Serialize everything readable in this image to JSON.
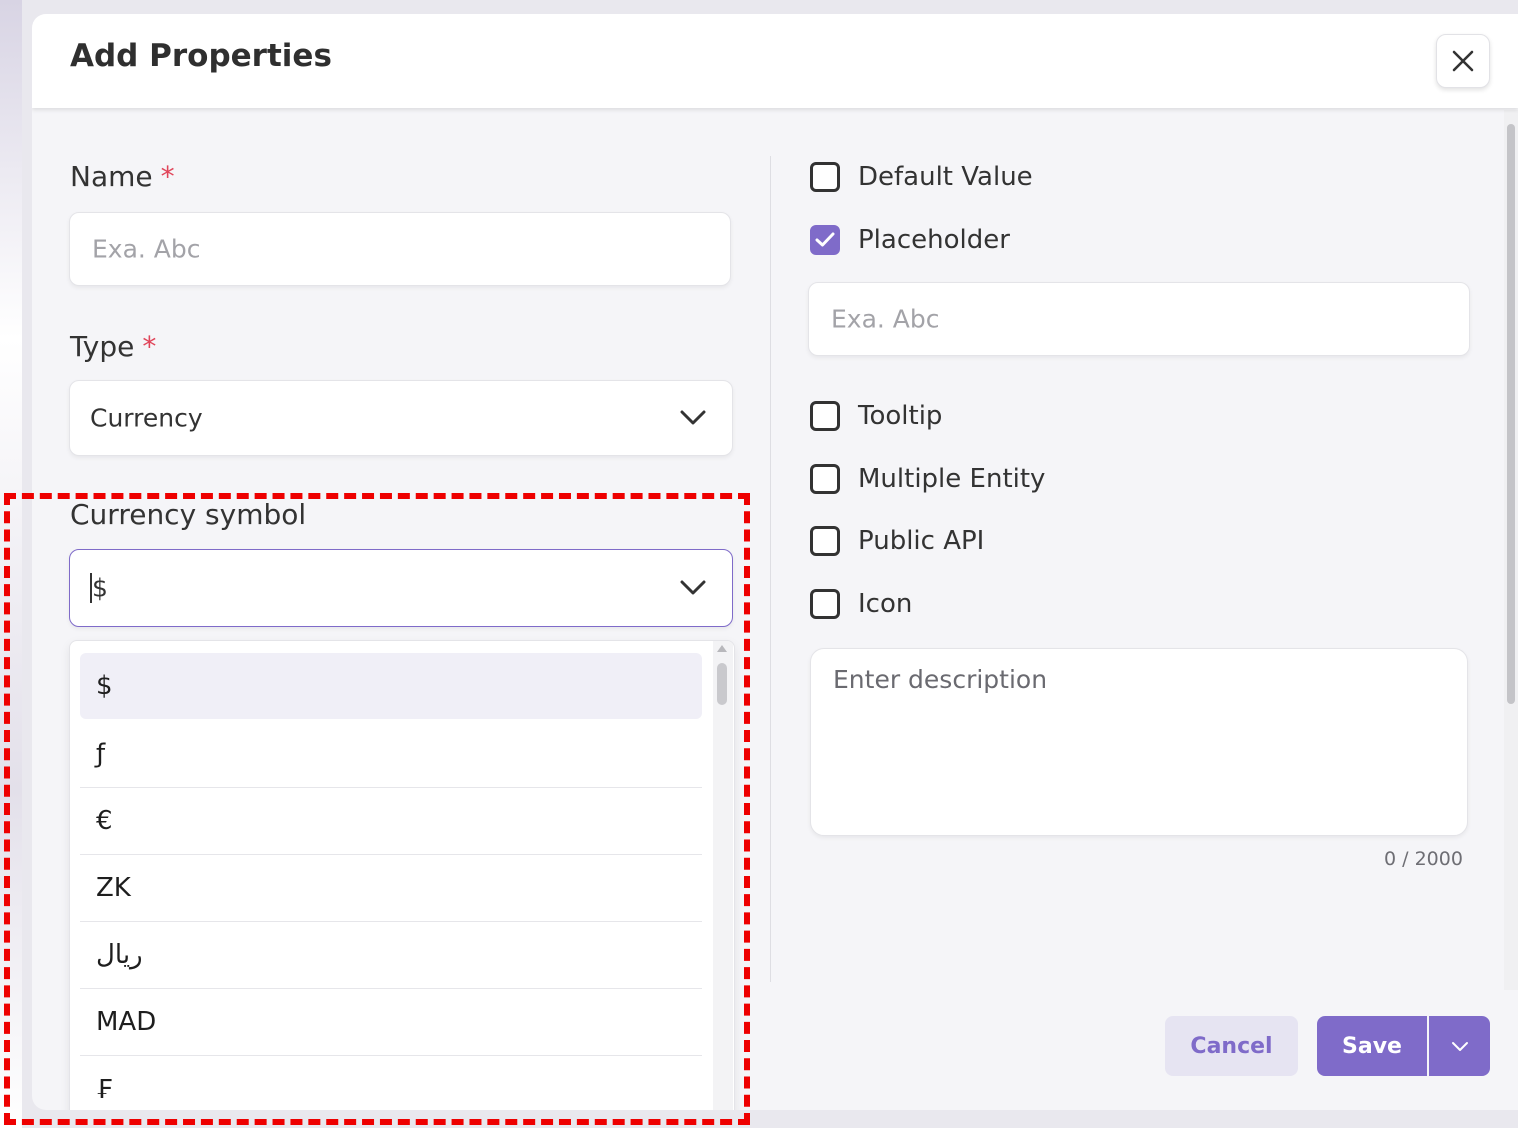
{
  "dialog": {
    "title": "Add Properties"
  },
  "form": {
    "name_label": "Name",
    "name_required": "*",
    "name_placeholder": "Exa. Abc",
    "type_label": "Type",
    "type_required": "*",
    "type_value": "Currency",
    "currency_symbol_label": "Currency symbol",
    "currency_symbol_value": "$",
    "currency_options": [
      "$",
      "ƒ",
      "€",
      "ZK",
      "ریال",
      "MAD",
      "₣"
    ]
  },
  "options": {
    "default_value": {
      "label": "Default Value",
      "checked": false
    },
    "placeholder": {
      "label": "Placeholder",
      "checked": true
    },
    "placeholder_input": "Exa. Abc",
    "tooltip": {
      "label": "Tooltip",
      "checked": false
    },
    "multiple_entity": {
      "label": "Multiple Entity",
      "checked": false
    },
    "public_api": {
      "label": "Public API",
      "checked": false
    },
    "icon": {
      "label": "Icon",
      "checked": false
    },
    "description_placeholder": "Enter description",
    "char_count": "0 / 2000"
  },
  "footer": {
    "cancel_label": "Cancel",
    "save_label": "Save"
  },
  "colors": {
    "accent": "#7f6bc9",
    "required": "#e0455a",
    "highlight": "#ee0000"
  }
}
